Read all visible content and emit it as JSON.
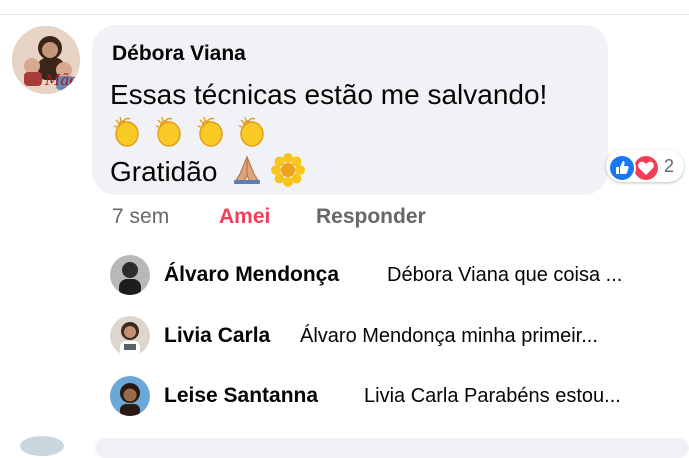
{
  "main_comment": {
    "author": "Débora Viana",
    "line1": "Essas técnicas estão me salvando!",
    "line3_text": "Gratidão",
    "reaction_count": "2",
    "actions": {
      "time": "7 sem",
      "love": "Amei",
      "reply": "Responder"
    },
    "avatar_caption": "Mãe"
  },
  "replies": [
    {
      "author": "Álvaro Mendonça",
      "text": "Débora Viana que coisa ..."
    },
    {
      "author": "Livia Carla",
      "text": "Álvaro Mendonça minha primeir..."
    },
    {
      "author": "Leise Santanna",
      "text": "Livia Carla Parabéns estou..."
    }
  ],
  "colors": {
    "bubble": "#f0f2f5",
    "love": "#f33e58",
    "like": "#1877f2",
    "muted": "#65676b"
  },
  "icons": [
    "clap-emoji",
    "praying-hands-emoji",
    "sunflower-emoji",
    "like-reaction-icon",
    "love-reaction-icon"
  ]
}
